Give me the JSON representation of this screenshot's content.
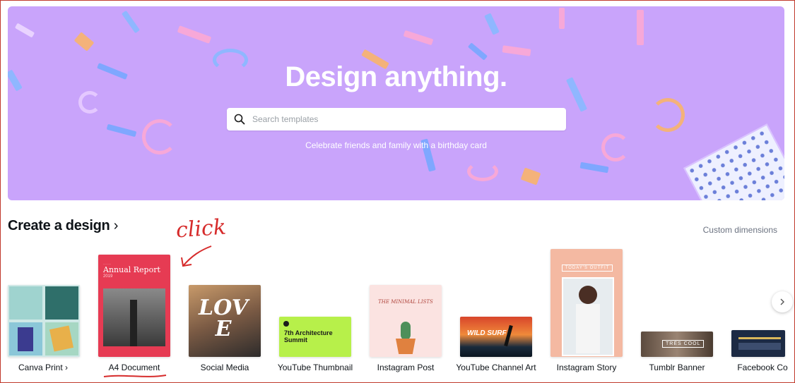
{
  "hero": {
    "title": "Design anything.",
    "search_placeholder": "Search templates",
    "subtitle": "Celebrate friends and family with a birthday card",
    "background_color": "#c9a4fb"
  },
  "section": {
    "title": "Create a design",
    "title_chevron": "›",
    "custom_dimensions": "Custom dimensions"
  },
  "annotation": {
    "text": "click",
    "color": "#d62b2b"
  },
  "designs": [
    {
      "label": "Canva Print",
      "suffix": "›"
    },
    {
      "label": "A4 Document",
      "thumb_title": "Annual Report",
      "thumb_year": "2019"
    },
    {
      "label": "Social Media",
      "thumb_text": "LOVE"
    },
    {
      "label": "YouTube Thumbnail",
      "thumb_text": "7th Architecture Summit"
    },
    {
      "label": "Instagram Post",
      "thumb_text": "THE MINIMAL LISTS"
    },
    {
      "label": "YouTube Channel Art",
      "thumb_text": "WILD SURF"
    },
    {
      "label": "Instagram Story",
      "thumb_text": "TODAY'S OUTFIT"
    },
    {
      "label": "Tumblr Banner",
      "thumb_text": "TRÈS COOL"
    },
    {
      "label": "Facebook Co"
    }
  ],
  "icons": {
    "search": "search-icon",
    "next": "chevron-right-icon"
  }
}
